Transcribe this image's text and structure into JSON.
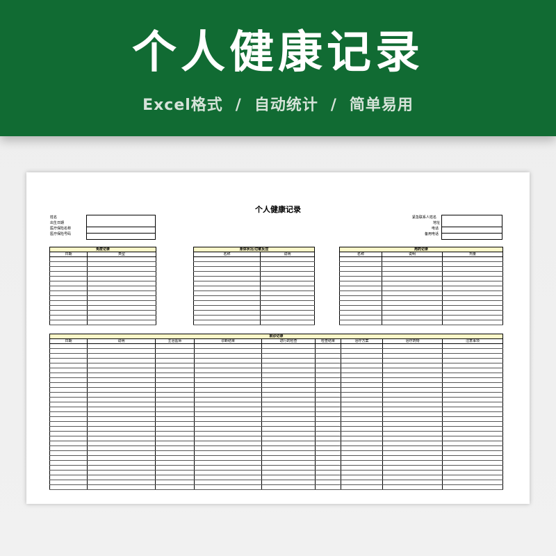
{
  "banner": {
    "title": "个人健康记录",
    "subtitle_parts": [
      "Excel格式",
      "/",
      "自动统计",
      "/",
      "简单易用"
    ],
    "bg_color": "#116b33"
  },
  "sheet": {
    "title": "个人健康记录",
    "personal_fields": [
      "姓名",
      "出生日期",
      "医疗保险名称",
      "医疗保险号码"
    ],
    "emergency_fields": [
      "紧急联系人姓名",
      "地址",
      "电话",
      "备用电话"
    ],
    "tables": {
      "vaccination": {
        "caption": "免疫记录",
        "headers": [
          "日期",
          "类型"
        ],
        "rows": 14
      },
      "allergies": {
        "caption": "身体状况/过敏反应",
        "headers": [
          "名称",
          "说明"
        ],
        "rows": 14
      },
      "medications": {
        "caption": "用药记录",
        "headers": [
          "名称",
          "说明",
          "剂量"
        ],
        "rows": 14
      },
      "visits": {
        "caption": "就诊记录",
        "headers": [
          "日期",
          "说明",
          "主治医师",
          "诊断结果",
          "进行的检查",
          "检查结果",
          "治疗方案",
          "治疗药物",
          "注意事项"
        ],
        "rows": 30
      }
    },
    "header_fill_color": "#fbf7c8"
  }
}
